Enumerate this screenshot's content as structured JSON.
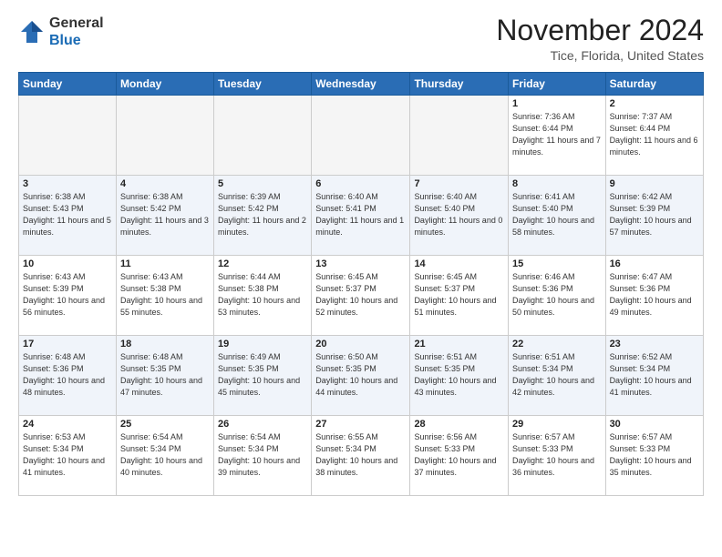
{
  "header": {
    "logo_general": "General",
    "logo_blue": "Blue",
    "month": "November 2024",
    "location": "Tice, Florida, United States"
  },
  "weekdays": [
    "Sunday",
    "Monday",
    "Tuesday",
    "Wednesday",
    "Thursday",
    "Friday",
    "Saturday"
  ],
  "weeks": [
    [
      {
        "day": "",
        "empty": true
      },
      {
        "day": "",
        "empty": true
      },
      {
        "day": "",
        "empty": true
      },
      {
        "day": "",
        "empty": true
      },
      {
        "day": "",
        "empty": true
      },
      {
        "day": "1",
        "sunrise": "Sunrise: 7:36 AM",
        "sunset": "Sunset: 6:44 PM",
        "daylight": "Daylight: 11 hours and 7 minutes."
      },
      {
        "day": "2",
        "sunrise": "Sunrise: 7:37 AM",
        "sunset": "Sunset: 6:44 PM",
        "daylight": "Daylight: 11 hours and 6 minutes."
      }
    ],
    [
      {
        "day": "3",
        "sunrise": "Sunrise: 6:38 AM",
        "sunset": "Sunset: 5:43 PM",
        "daylight": "Daylight: 11 hours and 5 minutes."
      },
      {
        "day": "4",
        "sunrise": "Sunrise: 6:38 AM",
        "sunset": "Sunset: 5:42 PM",
        "daylight": "Daylight: 11 hours and 3 minutes."
      },
      {
        "day": "5",
        "sunrise": "Sunrise: 6:39 AM",
        "sunset": "Sunset: 5:42 PM",
        "daylight": "Daylight: 11 hours and 2 minutes."
      },
      {
        "day": "6",
        "sunrise": "Sunrise: 6:40 AM",
        "sunset": "Sunset: 5:41 PM",
        "daylight": "Daylight: 11 hours and 1 minute."
      },
      {
        "day": "7",
        "sunrise": "Sunrise: 6:40 AM",
        "sunset": "Sunset: 5:40 PM",
        "daylight": "Daylight: 11 hours and 0 minutes."
      },
      {
        "day": "8",
        "sunrise": "Sunrise: 6:41 AM",
        "sunset": "Sunset: 5:40 PM",
        "daylight": "Daylight: 10 hours and 58 minutes."
      },
      {
        "day": "9",
        "sunrise": "Sunrise: 6:42 AM",
        "sunset": "Sunset: 5:39 PM",
        "daylight": "Daylight: 10 hours and 57 minutes."
      }
    ],
    [
      {
        "day": "10",
        "sunrise": "Sunrise: 6:43 AM",
        "sunset": "Sunset: 5:39 PM",
        "daylight": "Daylight: 10 hours and 56 minutes."
      },
      {
        "day": "11",
        "sunrise": "Sunrise: 6:43 AM",
        "sunset": "Sunset: 5:38 PM",
        "daylight": "Daylight: 10 hours and 55 minutes."
      },
      {
        "day": "12",
        "sunrise": "Sunrise: 6:44 AM",
        "sunset": "Sunset: 5:38 PM",
        "daylight": "Daylight: 10 hours and 53 minutes."
      },
      {
        "day": "13",
        "sunrise": "Sunrise: 6:45 AM",
        "sunset": "Sunset: 5:37 PM",
        "daylight": "Daylight: 10 hours and 52 minutes."
      },
      {
        "day": "14",
        "sunrise": "Sunrise: 6:45 AM",
        "sunset": "Sunset: 5:37 PM",
        "daylight": "Daylight: 10 hours and 51 minutes."
      },
      {
        "day": "15",
        "sunrise": "Sunrise: 6:46 AM",
        "sunset": "Sunset: 5:36 PM",
        "daylight": "Daylight: 10 hours and 50 minutes."
      },
      {
        "day": "16",
        "sunrise": "Sunrise: 6:47 AM",
        "sunset": "Sunset: 5:36 PM",
        "daylight": "Daylight: 10 hours and 49 minutes."
      }
    ],
    [
      {
        "day": "17",
        "sunrise": "Sunrise: 6:48 AM",
        "sunset": "Sunset: 5:36 PM",
        "daylight": "Daylight: 10 hours and 48 minutes."
      },
      {
        "day": "18",
        "sunrise": "Sunrise: 6:48 AM",
        "sunset": "Sunset: 5:35 PM",
        "daylight": "Daylight: 10 hours and 47 minutes."
      },
      {
        "day": "19",
        "sunrise": "Sunrise: 6:49 AM",
        "sunset": "Sunset: 5:35 PM",
        "daylight": "Daylight: 10 hours and 45 minutes."
      },
      {
        "day": "20",
        "sunrise": "Sunrise: 6:50 AM",
        "sunset": "Sunset: 5:35 PM",
        "daylight": "Daylight: 10 hours and 44 minutes."
      },
      {
        "day": "21",
        "sunrise": "Sunrise: 6:51 AM",
        "sunset": "Sunset: 5:35 PM",
        "daylight": "Daylight: 10 hours and 43 minutes."
      },
      {
        "day": "22",
        "sunrise": "Sunrise: 6:51 AM",
        "sunset": "Sunset: 5:34 PM",
        "daylight": "Daylight: 10 hours and 42 minutes."
      },
      {
        "day": "23",
        "sunrise": "Sunrise: 6:52 AM",
        "sunset": "Sunset: 5:34 PM",
        "daylight": "Daylight: 10 hours and 41 minutes."
      }
    ],
    [
      {
        "day": "24",
        "sunrise": "Sunrise: 6:53 AM",
        "sunset": "Sunset: 5:34 PM",
        "daylight": "Daylight: 10 hours and 41 minutes."
      },
      {
        "day": "25",
        "sunrise": "Sunrise: 6:54 AM",
        "sunset": "Sunset: 5:34 PM",
        "daylight": "Daylight: 10 hours and 40 minutes."
      },
      {
        "day": "26",
        "sunrise": "Sunrise: 6:54 AM",
        "sunset": "Sunset: 5:34 PM",
        "daylight": "Daylight: 10 hours and 39 minutes."
      },
      {
        "day": "27",
        "sunrise": "Sunrise: 6:55 AM",
        "sunset": "Sunset: 5:34 PM",
        "daylight": "Daylight: 10 hours and 38 minutes."
      },
      {
        "day": "28",
        "sunrise": "Sunrise: 6:56 AM",
        "sunset": "Sunset: 5:33 PM",
        "daylight": "Daylight: 10 hours and 37 minutes."
      },
      {
        "day": "29",
        "sunrise": "Sunrise: 6:57 AM",
        "sunset": "Sunset: 5:33 PM",
        "daylight": "Daylight: 10 hours and 36 minutes."
      },
      {
        "day": "30",
        "sunrise": "Sunrise: 6:57 AM",
        "sunset": "Sunset: 5:33 PM",
        "daylight": "Daylight: 10 hours and 35 minutes."
      }
    ]
  ]
}
